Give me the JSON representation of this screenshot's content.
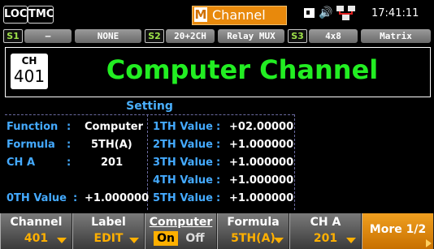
{
  "topbar": {
    "loc": "LOC",
    "tmc": "TMC",
    "window_letter": "M",
    "window_title": "Channel",
    "time": "17:41:11"
  },
  "slots": [
    {
      "label": "S1",
      "value": "—"
    },
    {
      "label": "",
      "value": "NONE"
    },
    {
      "label": "S2",
      "value": "20+2CH"
    },
    {
      "label": "",
      "value": "Relay MUX"
    },
    {
      "label": "S3",
      "value": "4x8"
    },
    {
      "label": "",
      "value": "Matrix"
    }
  ],
  "channel": {
    "ch_label": "CH",
    "ch_number": "401",
    "title": "Computer Channel"
  },
  "setting": {
    "heading": "Setting",
    "left_rows": [
      {
        "label": "Function",
        "value": "Computer"
      },
      {
        "label": "Formula",
        "value": "5TH(A)"
      },
      {
        "label": "CH A",
        "value": "201"
      },
      {
        "label": "",
        "value": ""
      },
      {
        "label": "0TH Value",
        "value": "+1.000000"
      }
    ],
    "right_rows": [
      {
        "label": "1TH Value",
        "value": "+02.00000"
      },
      {
        "label": "2TH Value",
        "value": "+1.000000"
      },
      {
        "label": "3TH Value",
        "value": "+1.000000"
      },
      {
        "label": "4TH Value",
        "value": "+1.000000"
      },
      {
        "label": "5TH Value",
        "value": "+1.000000"
      }
    ]
  },
  "softkeys": [
    {
      "title": "Channel",
      "value": "401"
    },
    {
      "title": "Label",
      "value": "EDIT"
    },
    {
      "title": "Computer",
      "on": "On",
      "off": "Off"
    },
    {
      "title": "Formula",
      "value": "5TH(A)"
    },
    {
      "title": "CH A",
      "value": "201"
    },
    {
      "title": "More 1/2"
    }
  ],
  "colors": {
    "accent_orange": "#e8890c",
    "title_green": "#22ee22",
    "label_blue": "#44aaff",
    "softkey_value": "#ffb000"
  }
}
